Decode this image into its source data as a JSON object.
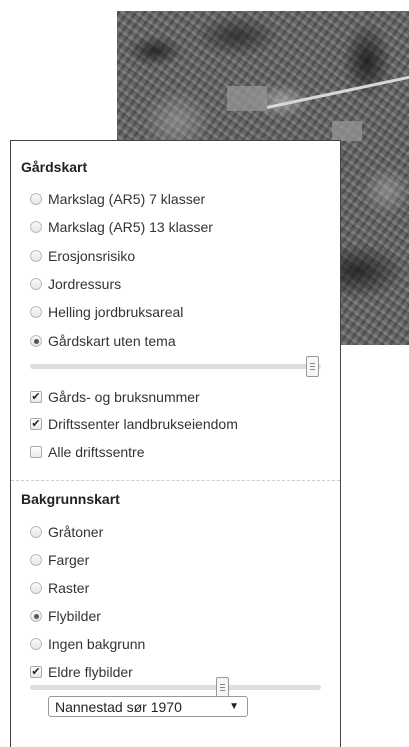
{
  "gardskart": {
    "title": "Gårdskart",
    "radios": [
      {
        "label": "Markslag (AR5) 7 klasser",
        "checked": false
      },
      {
        "label": "Markslag (AR5) 13 klasser",
        "checked": false
      },
      {
        "label": "Erosjonsrisiko",
        "checked": false
      },
      {
        "label": "Jordressurs",
        "checked": false
      },
      {
        "label": "Helling jordbruksareal",
        "checked": false
      },
      {
        "label": "Gårdskart uten tema",
        "checked": true
      }
    ],
    "opacity_slider_value": 0.95,
    "checkboxes": [
      {
        "label": "Gårds- og bruksnummer",
        "checked": true
      },
      {
        "label": "Driftssenter landbrukseiendom",
        "checked": true
      },
      {
        "label": "Alle driftssentre",
        "checked": false
      }
    ]
  },
  "bakgrunnskart": {
    "title": "Bakgrunnskart",
    "radios": [
      {
        "label": "Gråtoner",
        "checked": false
      },
      {
        "label": "Farger",
        "checked": false
      },
      {
        "label": "Raster",
        "checked": false
      },
      {
        "label": "Flybilder",
        "checked": true
      },
      {
        "label": "Ingen bakgrunn",
        "checked": false
      }
    ],
    "checkboxes": [
      {
        "label": "Eldre flybilder",
        "checked": true
      }
    ],
    "opacity_slider_value": 0.67,
    "select_value": "Nannestad sør 1970"
  },
  "icons": {
    "checkmark": "✔",
    "dropdown_arrow": "▼"
  }
}
